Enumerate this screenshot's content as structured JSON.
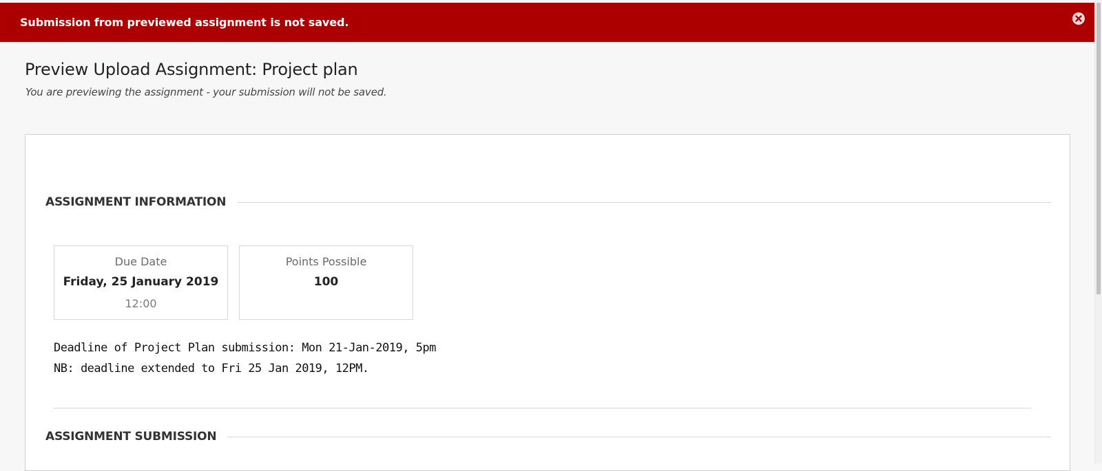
{
  "banner": {
    "message": "Submission from previewed assignment is not saved.",
    "close_icon": "close-circle-icon",
    "background_color": "#ac0000"
  },
  "page": {
    "title": "Preview Upload Assignment: Project plan",
    "subtitle": "You are previewing the assignment - your submission will not be saved."
  },
  "assignment_information": {
    "heading": "ASSIGNMENT INFORMATION",
    "due_date": {
      "label": "Due Date",
      "value": "Friday, 25 January 2019",
      "time": "12:00"
    },
    "points_possible": {
      "label": "Points Possible",
      "value": "100"
    },
    "instructions": [
      "Deadline of Project Plan submission: Mon 21-Jan-2019, 5pm",
      "NB: deadline extended to Fri 25 Jan 2019, 12PM."
    ]
  },
  "assignment_submission": {
    "heading": "ASSIGNMENT SUBMISSION"
  }
}
